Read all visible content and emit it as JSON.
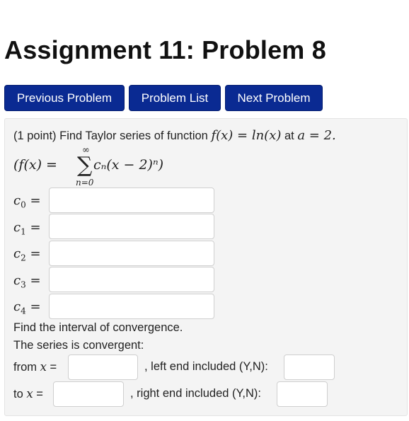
{
  "page": {
    "title": "Assignment 11: Problem 8"
  },
  "nav": {
    "prev_label": "Previous Problem",
    "list_label": "Problem List",
    "next_label": "Next Problem"
  },
  "problem": {
    "points": "(1 point)",
    "intro": "Find Taylor series of function",
    "func": "f(x) = ln(x)",
    "at_text": "at",
    "point": "a = 2.",
    "sum_lhs": "(f(x) =",
    "sum_upper": "∞",
    "sum_lower": "n=0",
    "sum_term": "cₙ(x − 2)ⁿ)",
    "coefficients": [
      {
        "name": "c",
        "sub": "0",
        "eq": "=",
        "value": ""
      },
      {
        "name": "c",
        "sub": "1",
        "eq": "=",
        "value": ""
      },
      {
        "name": "c",
        "sub": "2",
        "eq": "=",
        "value": ""
      },
      {
        "name": "c",
        "sub": "3",
        "eq": "=",
        "value": ""
      },
      {
        "name": "c",
        "sub": "4",
        "eq": "=",
        "value": ""
      }
    ],
    "interval_prompt": "Find the interval of convergence.",
    "convergent_text": "The series is convergent:",
    "from_label": "from",
    "var_x": "x",
    "eq_sign": "=",
    "from_value": "",
    "left_end_label": ", left end included (Y,N):",
    "left_end_value": "",
    "to_label": "to",
    "to_value": "",
    "right_end_label": ", right end included (Y,N):",
    "right_end_value": ""
  }
}
